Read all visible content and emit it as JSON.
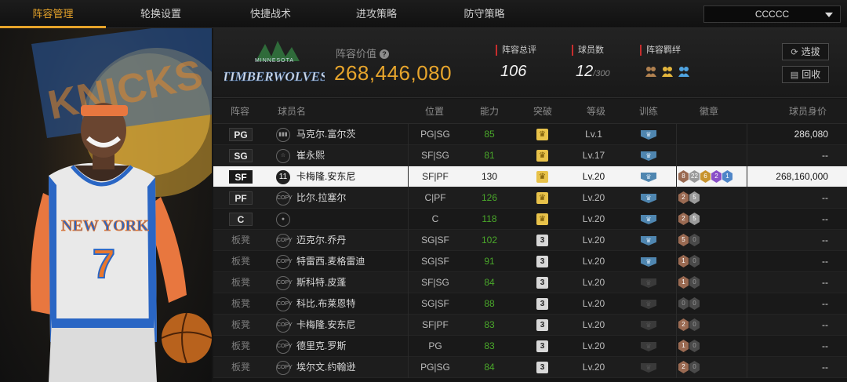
{
  "nav": {
    "tabs": [
      "阵容管理",
      "轮换设置",
      "快捷战术",
      "进攻策略",
      "防守策略"
    ],
    "active_tab": 0,
    "team_select": "CCCCC"
  },
  "summary": {
    "team_logo_name": "TIMBERWOLVES",
    "team_logo_city": "MINNESOTA",
    "value_label": "阵容价值",
    "value": "268,446,080",
    "rating_label": "阵容总评",
    "rating": "106",
    "count_label": "球员数",
    "count": "12",
    "count_max": "/300",
    "bond_label": "阵容羁绊",
    "select_button": "选拔",
    "recycle_button": "回收"
  },
  "table": {
    "headers": [
      "阵容",
      "球员名",
      "位置",
      "能力",
      "突破",
      "等级",
      "训练",
      "徽章",
      "球员身价"
    ],
    "rows": [
      {
        "pos": "PG",
        "bench": false,
        "icon": "bars",
        "name": "马克尔.富尔茨",
        "ppos": "PG|SG",
        "abil": "85",
        "brk": "crown",
        "lvl": "Lv.1",
        "train": "on",
        "badges": [],
        "price": "286,080"
      },
      {
        "pos": "SG",
        "bench": false,
        "icon": "star",
        "name": "崔永熙",
        "ppos": "SF|SG",
        "abil": "81",
        "brk": "crown",
        "lvl": "Lv.17",
        "train": "on",
        "badges": [],
        "price": "--"
      },
      {
        "pos": "SF",
        "bench": false,
        "icon": "jersey",
        "name": "卡梅隆.安东尼",
        "ppos": "SF|PF",
        "abil": "130",
        "brk": "crown",
        "lvl": "Lv.20",
        "train": "on",
        "badges": [
          {
            "t": "8",
            "c": "br"
          },
          {
            "t": "22",
            "c": "si"
          },
          {
            "t": "6",
            "c": "go"
          },
          {
            "t": "2",
            "c": "pu"
          },
          {
            "t": "1",
            "c": "bl"
          }
        ],
        "price": "268,160,000",
        "selected": true
      },
      {
        "pos": "PF",
        "bench": false,
        "icon": "copy",
        "name": "比尔.拉塞尔",
        "ppos": "C|PF",
        "abil": "126",
        "brk": "crown",
        "lvl": "Lv.20",
        "train": "on",
        "badges": [
          {
            "t": "2",
            "c": "br"
          },
          {
            "t": "5",
            "c": "si"
          }
        ],
        "price": "--"
      },
      {
        "pos": "C",
        "bench": false,
        "icon": "person",
        "name": "",
        "ppos": "C",
        "abil": "118",
        "brk": "crown",
        "lvl": "Lv.20",
        "train": "on",
        "badges": [
          {
            "t": "2",
            "c": "br"
          },
          {
            "t": "5",
            "c": "si"
          }
        ],
        "price": "--"
      },
      {
        "pos": "板凳",
        "bench": true,
        "icon": "copy",
        "name": "迈克尔.乔丹",
        "ppos": "SG|SF",
        "abil": "102",
        "brk": "3",
        "lvl": "Lv.20",
        "train": "on",
        "badges": [
          {
            "t": "5",
            "c": "br"
          },
          {
            "t": "0",
            "c": "dk"
          }
        ],
        "price": "--"
      },
      {
        "pos": "板凳",
        "bench": true,
        "icon": "copy",
        "name": "特雷西.麦格雷迪",
        "ppos": "SG|SF",
        "abil": "91",
        "brk": "3",
        "lvl": "Lv.20",
        "train": "on",
        "badges": [
          {
            "t": "1",
            "c": "br"
          },
          {
            "t": "0",
            "c": "dk"
          }
        ],
        "price": "--"
      },
      {
        "pos": "板凳",
        "bench": true,
        "icon": "copy",
        "name": "斯科特.皮蓬",
        "ppos": "SF|SG",
        "abil": "84",
        "brk": "3",
        "lvl": "Lv.20",
        "train": "off",
        "badges": [
          {
            "t": "1",
            "c": "br"
          },
          {
            "t": "0",
            "c": "dk"
          }
        ],
        "price": "--"
      },
      {
        "pos": "板凳",
        "bench": true,
        "icon": "copy",
        "name": "科比.布莱恩特",
        "ppos": "SG|SF",
        "abil": "88",
        "brk": "3",
        "lvl": "Lv.20",
        "train": "off",
        "badges": [
          {
            "t": "0",
            "c": "dk"
          },
          {
            "t": "0",
            "c": "dk"
          }
        ],
        "price": "--"
      },
      {
        "pos": "板凳",
        "bench": true,
        "icon": "copy",
        "name": "卡梅隆.安东尼",
        "ppos": "SF|PF",
        "abil": "83",
        "brk": "3",
        "lvl": "Lv.20",
        "train": "off",
        "badges": [
          {
            "t": "2",
            "c": "br"
          },
          {
            "t": "0",
            "c": "dk"
          }
        ],
        "price": "--"
      },
      {
        "pos": "板凳",
        "bench": true,
        "icon": "copy",
        "name": "德里克.罗斯",
        "ppos": "PG",
        "abil": "83",
        "brk": "3",
        "lvl": "Lv.20",
        "train": "off",
        "badges": [
          {
            "t": "1",
            "c": "br"
          },
          {
            "t": "0",
            "c": "dk"
          }
        ],
        "price": "--"
      },
      {
        "pos": "板凳",
        "bench": true,
        "icon": "copy",
        "name": "埃尔文.约翰逊",
        "ppos": "PG|SG",
        "abil": "84",
        "brk": "3",
        "lvl": "Lv.20",
        "train": "off",
        "badges": [
          {
            "t": "2",
            "c": "br"
          },
          {
            "t": "0",
            "c": "dk"
          }
        ],
        "price": "--"
      }
    ]
  },
  "colors": {
    "accent": "#e6a32a",
    "selected_row": "#f4f4f4",
    "ability_green": "#4aa82a"
  }
}
